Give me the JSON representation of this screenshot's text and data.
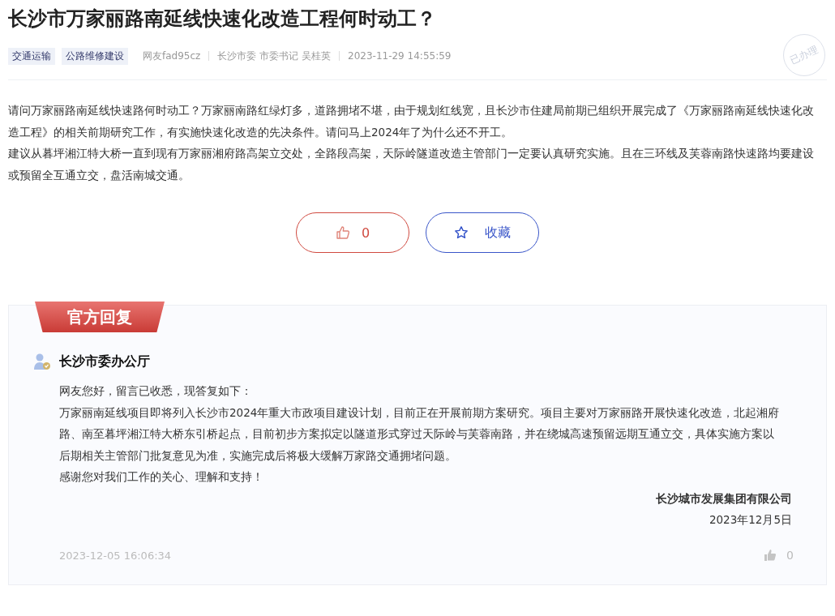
{
  "title": "长沙市万家丽路南延线快速化改造工程何时动工？",
  "tags": [
    "交通运输",
    "公路维修建设"
  ],
  "meta": {
    "author": "网友fad95cz",
    "recipient": "长沙市委 市委书记 吴桂英",
    "time": "2023-11-29 14:55:59"
  },
  "status_stamp": "已办理",
  "body": [
    "请问万家丽路南延线快速路何时动工？万家丽南路红绿灯多，道路拥堵不堪，由于规划红线宽，且长沙市住建局前期已组织开展完成了《万家丽路南延线快速化改造工程》的相关前期研究工作，有实施快速化改造的先决条件。请问马上2024年了为什么还不开工。",
    "建议从暮坪湘江特大桥一直到现有万家丽湘府路高架立交处，全路段高架，天际岭隧道改造主管部门一定要认真研究实施。且在三环线及芙蓉南路快速路均要建设或预留全互通立交，盘活南城交通。"
  ],
  "actions": [
    {
      "kind": "like",
      "text": "0"
    },
    {
      "kind": "favorite",
      "text": "收藏"
    }
  ],
  "reply": {
    "banner": "官方回复",
    "responder": "长沙市委办公厅",
    "paragraphs": [
      "网友您好，留言已收悉，现答复如下：",
      "万家丽南延线项目即将列入长沙市2024年重大市政项目建设计划，目前正在开展前期方案研究。项目主要对万家丽路开展快速化改造，北起湘府路、南至暮坪湘江特大桥东引桥起点，目前初步方案拟定以隧道形式穿过天际岭与芙蓉南路，并在绕城高速预留远期互通立交，具体实施方案以后期相关主管部门批复意见为准，实施完成后将极大缓解万家路交通拥堵问题。",
      "感谢您对我们工作的关心、理解和支持！"
    ],
    "signature": "长沙城市发展集团有限公司",
    "date": "2023年12月5日",
    "time": "2023-12-05 16:06:34",
    "likes": "0"
  }
}
